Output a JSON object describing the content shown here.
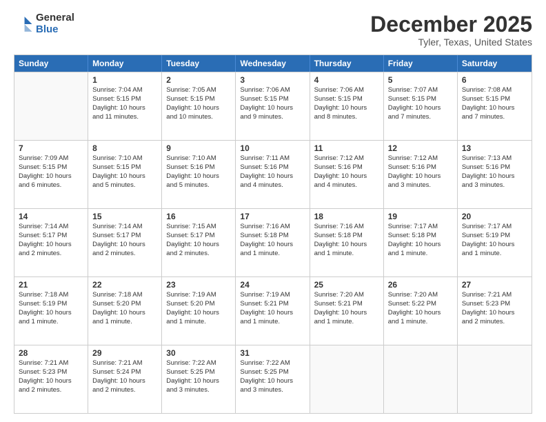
{
  "logo": {
    "general": "General",
    "blue": "Blue"
  },
  "header": {
    "month": "December 2025",
    "location": "Tyler, Texas, United States"
  },
  "weekdays": [
    "Sunday",
    "Monday",
    "Tuesday",
    "Wednesday",
    "Thursday",
    "Friday",
    "Saturday"
  ],
  "weeks": [
    [
      {
        "day": "",
        "info": ""
      },
      {
        "day": "1",
        "info": "Sunrise: 7:04 AM\nSunset: 5:15 PM\nDaylight: 10 hours\nand 11 minutes."
      },
      {
        "day": "2",
        "info": "Sunrise: 7:05 AM\nSunset: 5:15 PM\nDaylight: 10 hours\nand 10 minutes."
      },
      {
        "day": "3",
        "info": "Sunrise: 7:06 AM\nSunset: 5:15 PM\nDaylight: 10 hours\nand 9 minutes."
      },
      {
        "day": "4",
        "info": "Sunrise: 7:06 AM\nSunset: 5:15 PM\nDaylight: 10 hours\nand 8 minutes."
      },
      {
        "day": "5",
        "info": "Sunrise: 7:07 AM\nSunset: 5:15 PM\nDaylight: 10 hours\nand 7 minutes."
      },
      {
        "day": "6",
        "info": "Sunrise: 7:08 AM\nSunset: 5:15 PM\nDaylight: 10 hours\nand 7 minutes."
      }
    ],
    [
      {
        "day": "7",
        "info": "Sunrise: 7:09 AM\nSunset: 5:15 PM\nDaylight: 10 hours\nand 6 minutes."
      },
      {
        "day": "8",
        "info": "Sunrise: 7:10 AM\nSunset: 5:15 PM\nDaylight: 10 hours\nand 5 minutes."
      },
      {
        "day": "9",
        "info": "Sunrise: 7:10 AM\nSunset: 5:16 PM\nDaylight: 10 hours\nand 5 minutes."
      },
      {
        "day": "10",
        "info": "Sunrise: 7:11 AM\nSunset: 5:16 PM\nDaylight: 10 hours\nand 4 minutes."
      },
      {
        "day": "11",
        "info": "Sunrise: 7:12 AM\nSunset: 5:16 PM\nDaylight: 10 hours\nand 4 minutes."
      },
      {
        "day": "12",
        "info": "Sunrise: 7:12 AM\nSunset: 5:16 PM\nDaylight: 10 hours\nand 3 minutes."
      },
      {
        "day": "13",
        "info": "Sunrise: 7:13 AM\nSunset: 5:16 PM\nDaylight: 10 hours\nand 3 minutes."
      }
    ],
    [
      {
        "day": "14",
        "info": "Sunrise: 7:14 AM\nSunset: 5:17 PM\nDaylight: 10 hours\nand 2 minutes."
      },
      {
        "day": "15",
        "info": "Sunrise: 7:14 AM\nSunset: 5:17 PM\nDaylight: 10 hours\nand 2 minutes."
      },
      {
        "day": "16",
        "info": "Sunrise: 7:15 AM\nSunset: 5:17 PM\nDaylight: 10 hours\nand 2 minutes."
      },
      {
        "day": "17",
        "info": "Sunrise: 7:16 AM\nSunset: 5:18 PM\nDaylight: 10 hours\nand 1 minute."
      },
      {
        "day": "18",
        "info": "Sunrise: 7:16 AM\nSunset: 5:18 PM\nDaylight: 10 hours\nand 1 minute."
      },
      {
        "day": "19",
        "info": "Sunrise: 7:17 AM\nSunset: 5:18 PM\nDaylight: 10 hours\nand 1 minute."
      },
      {
        "day": "20",
        "info": "Sunrise: 7:17 AM\nSunset: 5:19 PM\nDaylight: 10 hours\nand 1 minute."
      }
    ],
    [
      {
        "day": "21",
        "info": "Sunrise: 7:18 AM\nSunset: 5:19 PM\nDaylight: 10 hours\nand 1 minute."
      },
      {
        "day": "22",
        "info": "Sunrise: 7:18 AM\nSunset: 5:20 PM\nDaylight: 10 hours\nand 1 minute."
      },
      {
        "day": "23",
        "info": "Sunrise: 7:19 AM\nSunset: 5:20 PM\nDaylight: 10 hours\nand 1 minute."
      },
      {
        "day": "24",
        "info": "Sunrise: 7:19 AM\nSunset: 5:21 PM\nDaylight: 10 hours\nand 1 minute."
      },
      {
        "day": "25",
        "info": "Sunrise: 7:20 AM\nSunset: 5:21 PM\nDaylight: 10 hours\nand 1 minute."
      },
      {
        "day": "26",
        "info": "Sunrise: 7:20 AM\nSunset: 5:22 PM\nDaylight: 10 hours\nand 1 minute."
      },
      {
        "day": "27",
        "info": "Sunrise: 7:21 AM\nSunset: 5:23 PM\nDaylight: 10 hours\nand 2 minutes."
      }
    ],
    [
      {
        "day": "28",
        "info": "Sunrise: 7:21 AM\nSunset: 5:23 PM\nDaylight: 10 hours\nand 2 minutes."
      },
      {
        "day": "29",
        "info": "Sunrise: 7:21 AM\nSunset: 5:24 PM\nDaylight: 10 hours\nand 2 minutes."
      },
      {
        "day": "30",
        "info": "Sunrise: 7:22 AM\nSunset: 5:25 PM\nDaylight: 10 hours\nand 3 minutes."
      },
      {
        "day": "31",
        "info": "Sunrise: 7:22 AM\nSunset: 5:25 PM\nDaylight: 10 hours\nand 3 minutes."
      },
      {
        "day": "",
        "info": ""
      },
      {
        "day": "",
        "info": ""
      },
      {
        "day": "",
        "info": ""
      }
    ]
  ]
}
